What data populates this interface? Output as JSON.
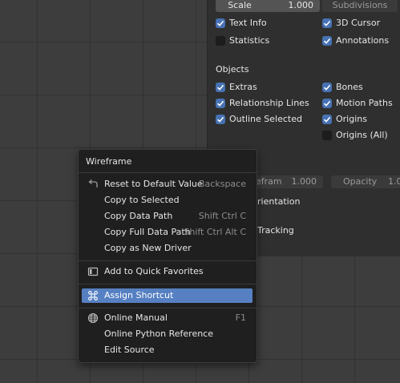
{
  "panel": {
    "scale_label": "Scale",
    "scale_value": "1.000",
    "subdivisions_label": "Subdivisions",
    "checks_top": [
      {
        "label": "Text Info",
        "checked": true
      },
      {
        "label": "3D Cursor",
        "checked": true
      },
      {
        "label": "Statistics",
        "checked": false
      },
      {
        "label": "Annotations",
        "checked": true
      }
    ],
    "objects_heading": "Objects",
    "objects_checks": [
      {
        "label": "Extras",
        "checked": true
      },
      {
        "label": "Bones",
        "checked": true
      },
      {
        "label": "Relationship Lines",
        "checked": true
      },
      {
        "label": "Motion Paths",
        "checked": true
      },
      {
        "label": "Outline Selected",
        "checked": true
      },
      {
        "label": "Origins",
        "checked": true
      },
      {
        "label": "Origins (All)",
        "checked": false
      }
    ],
    "wireframe_partial": "efram",
    "wireframe_value": "1.000",
    "opacity_label": "Opacity",
    "opacity_value_partial": "1.0",
    "orientation_partial": "rientation",
    "tracking_partial": "Tracking"
  },
  "menu": {
    "title": "Wireframe",
    "items": [
      {
        "label": "Reset to Default Value",
        "shortcut": "Backspace",
        "icon": "reset-icon"
      },
      {
        "label": "Copy to Selected",
        "shortcut": ""
      },
      {
        "label": "Copy Data Path",
        "shortcut": "Shift Ctrl C"
      },
      {
        "label": "Copy Full Data Path",
        "shortcut": "Shift Ctrl Alt C"
      },
      {
        "label": "Copy as New Driver",
        "shortcut": ""
      },
      {
        "label": "Add to Quick Favorites",
        "shortcut": "",
        "icon": "favorites-icon"
      },
      {
        "label": "Assign Shortcut",
        "shortcut": "",
        "icon": "command-key-icon"
      },
      {
        "label": "Online Manual",
        "shortcut": "F1",
        "icon": "globe-icon"
      },
      {
        "label": "Online Python Reference",
        "shortcut": ""
      },
      {
        "label": "Edit Source",
        "shortcut": ""
      }
    ]
  },
  "colors": {
    "accent": "#4772b3",
    "highlight": "#5680c2",
    "menu_bg": "#1f1f1f",
    "panel_bg": "#2f2f2f"
  }
}
